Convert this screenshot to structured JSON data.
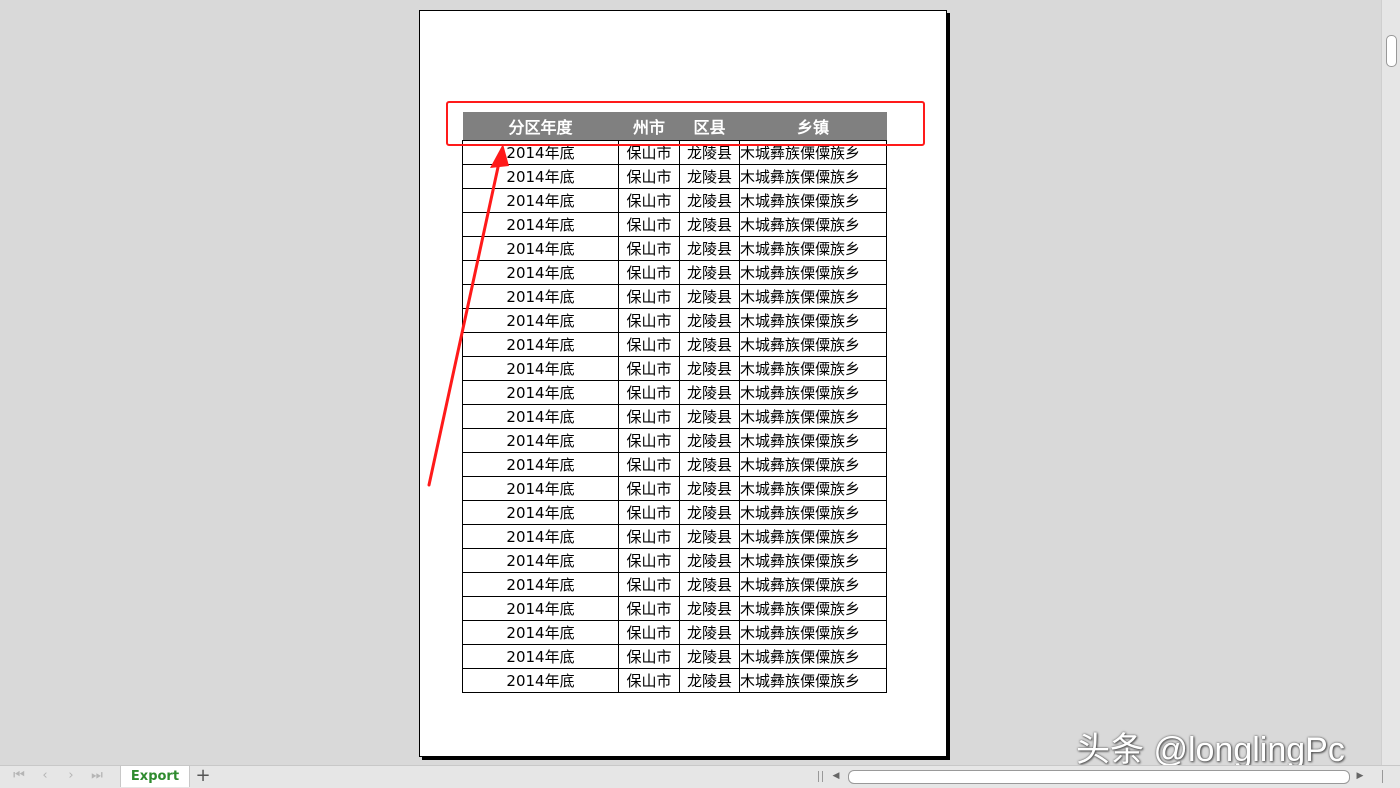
{
  "sheet": {
    "headers": [
      "分区年度",
      "州市",
      "区县",
      "乡镇"
    ],
    "row_template": {
      "year": "2014年底",
      "city": "保山市",
      "county": "龙陵县",
      "town": "木城彝族傈僳族乡"
    },
    "row_count": 23
  },
  "annotation": {
    "color": "#ff1a1a"
  },
  "tabs": {
    "active_label": "Export",
    "add_symbol": "+"
  },
  "watermark": "头条 @longlingPc",
  "colors": {
    "header_bg": "#808080",
    "tab_text": "#2e8b2e"
  }
}
